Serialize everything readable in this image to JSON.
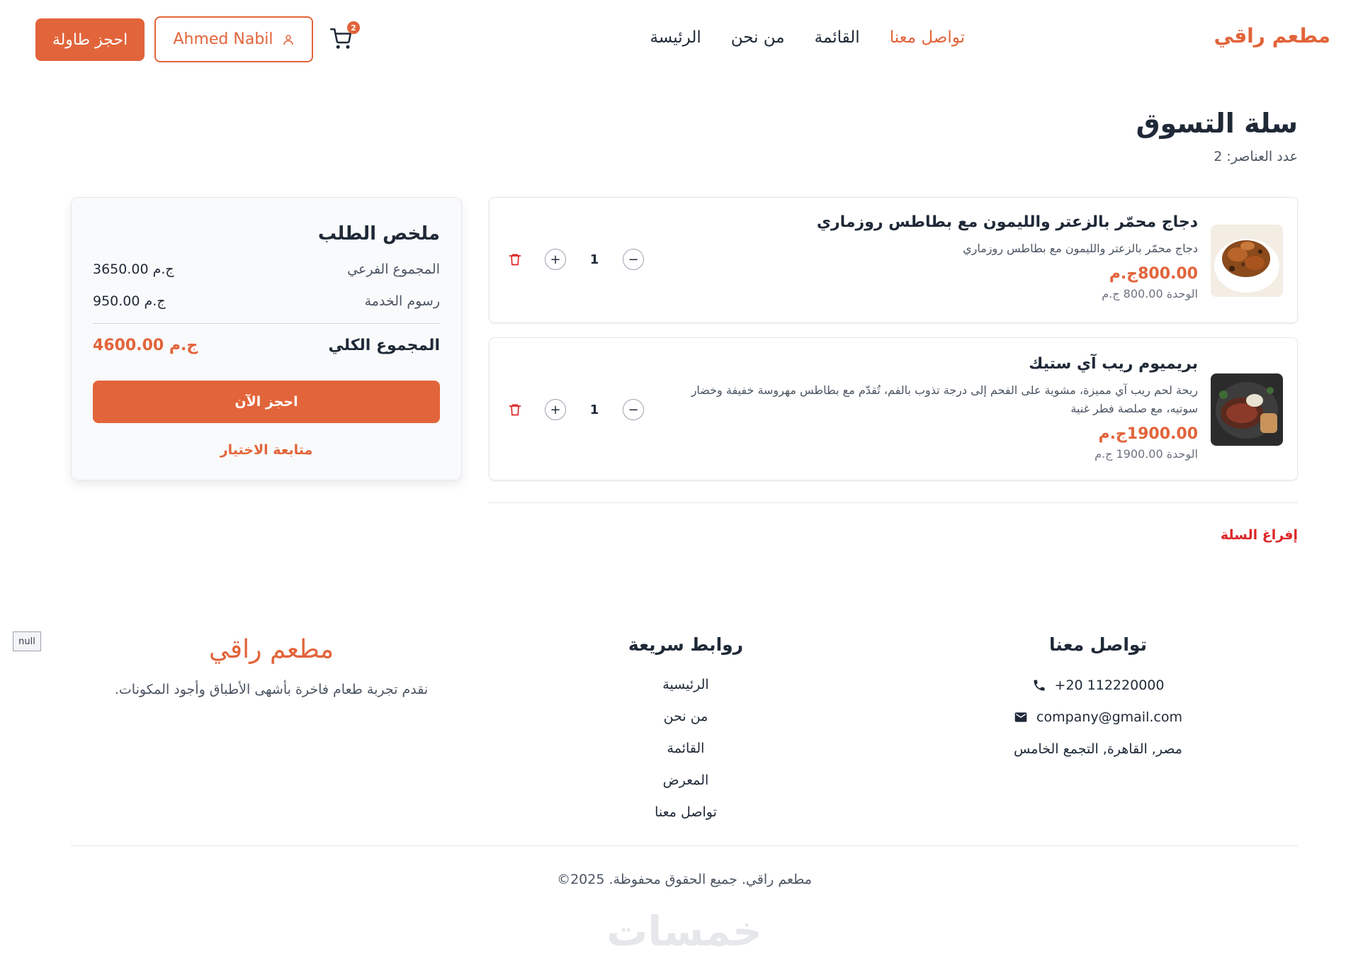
{
  "header": {
    "brand": "مطعم راقي",
    "nav": [
      {
        "label": "الرئيسة"
      },
      {
        "label": "من نحن"
      },
      {
        "label": "القائمة"
      },
      {
        "label": "تواصل معنا"
      }
    ],
    "cart_count": "2",
    "user_name": "Ahmed Nabil",
    "book_table": "احجز طاولة"
  },
  "cart": {
    "title": "سلة التسوق",
    "count_text": "عدد العناصر: 2",
    "items": [
      {
        "name": "دجاج محمّر بالزعتر والليمون مع بطاطس روزماري",
        "desc": "دجاج محمّر بالزعتر والليمون مع بطاطس روزماري",
        "price": "800.00ج.م",
        "unit": "الوحدة 800.00 ج.م",
        "qty": "1"
      },
      {
        "name": "بريميوم ريب آي ستيك",
        "desc": "ريحة لحم ريب آي مميزة، مشوية على الفحم إلى درجة تذوب بالفم، تُقدّم مع بطاطس مهروسة خفيفة وخضار سوتيه، مع صلصة فطر غنية",
        "price": "1900.00ج.م",
        "unit": "الوحدة 1900.00 ج.م",
        "qty": "1"
      }
    ],
    "clear": "إفراغ السلة"
  },
  "summary": {
    "title": "ملخص الطلب",
    "subtotal_label": "المجموع الفرعي",
    "subtotal_value": "3650.00 ج.م",
    "fee_label": "رسوم الخدمة",
    "fee_value": "950.00 ج.م",
    "total_label": "المجموع الكلي",
    "total_value": "4600.00 ج.م",
    "book_now": "احجز الآن",
    "continue": "متابعة الاختيار"
  },
  "footer": {
    "null_badge": "null",
    "brand": "مطعم راقي",
    "tagline": "نقدم تجربة طعام فاخرة بأشهى الأطباق وأجود المكونات.",
    "links_title": "روابط سريعة",
    "links": [
      {
        "label": "الرئيسية"
      },
      {
        "label": "من نحن"
      },
      {
        "label": "القائمة"
      },
      {
        "label": "المعرض"
      },
      {
        "label": "تواصل معنا"
      }
    ],
    "contact_title": "تواصل معنا",
    "phone": "+20 112220000",
    "email": "company@gmail.com",
    "address": "مصر, القاهرة, التجمع الخامس",
    "copyright": "مطعم راقي. جميع الحقوق محفوظة. 2025©",
    "watermark": "خمسات"
  },
  "colors": {
    "accent": "#e2643a",
    "danger": "#dc2626"
  },
  "icons": {
    "cart": "cart-icon",
    "user": "user-icon",
    "trash": "trash-icon",
    "phone": "phone-icon",
    "email": "envelope-icon"
  }
}
